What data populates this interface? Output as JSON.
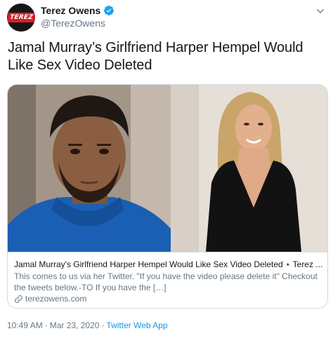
{
  "author": {
    "display_name": "Terez Owens",
    "handle": "@TerezOwens",
    "avatar_text": "TEREZ"
  },
  "tweet": {
    "text": "Jamal Murray’s Girlfriend Harper Hempel Would Like Sex Video Deleted"
  },
  "card": {
    "title": "Jamal Murray's Girlfriend Harper Hempel Would Like Sex Video Deleted ⋆ Terez ...",
    "description": "This comes to us via her Twitter. \"If you have the video please delete it\" Checkout the tweets below.-TO If you have the […]",
    "domain": "terezowens.com"
  },
  "meta": {
    "time": "10:49 AM",
    "separator": "·",
    "date": "Mar 23, 2020",
    "source": "Twitter Web App"
  },
  "colors": {
    "accent": "#1da1f2",
    "secondary_text": "#657786",
    "border": "#cfd9de"
  },
  "icons": [
    "verified-badge-icon",
    "chevron-down-icon",
    "link-icon"
  ]
}
